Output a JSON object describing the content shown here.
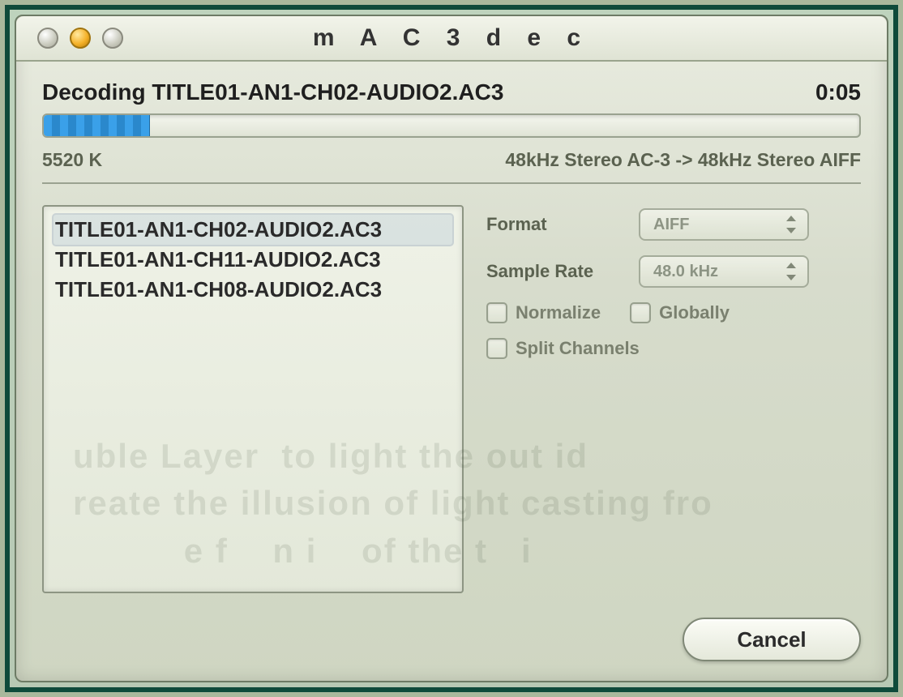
{
  "window": {
    "title": "m A C 3 d e c"
  },
  "status": {
    "label": "Decoding TITLE01-AN1-CH02-AUDIO2.AC3",
    "elapsed": "0:05"
  },
  "progress": {
    "percent": 13
  },
  "info": {
    "size": "5520 K",
    "conversion": "48kHz Stereo AC-3  ->  48kHz Stereo AIFF"
  },
  "files": [
    "TITLE01-AN1-CH02-AUDIO2.AC3",
    "TITLE01-AN1-CH11-AUDIO2.AC3",
    "TITLE01-AN1-CH08-AUDIO2.AC3"
  ],
  "options": {
    "format_label": "Format",
    "format_value": "AIFF",
    "rate_label": "Sample Rate",
    "rate_value": "48.0 kHz",
    "normalize_label": "Normalize",
    "globally_label": "Globally",
    "split_label": "Split Channels"
  },
  "buttons": {
    "cancel": "Cancel"
  }
}
